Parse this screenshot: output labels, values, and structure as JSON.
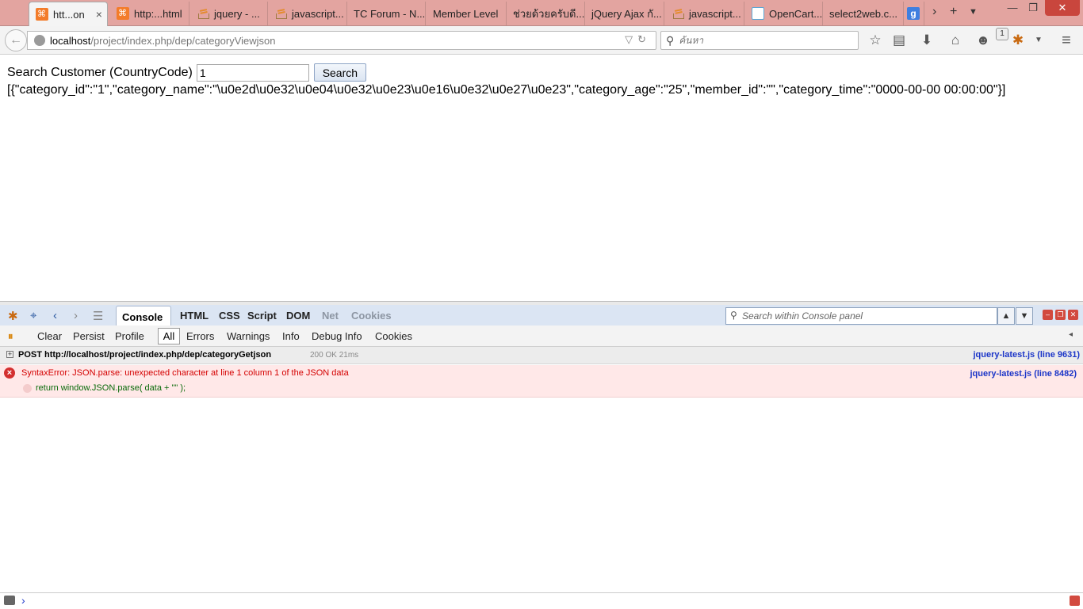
{
  "tabs": [
    {
      "label": "htt...on",
      "icon": "xampp-icon",
      "active": true
    },
    {
      "label": "http:...html",
      "icon": "xampp-icon"
    },
    {
      "label": "jquery - ...",
      "icon": "stackoverflow-icon"
    },
    {
      "label": "javascript...",
      "icon": "stackoverflow-icon"
    },
    {
      "label": "TC Forum - N...",
      "icon": ""
    },
    {
      "label": "Member Level",
      "icon": ""
    },
    {
      "label": "ช่วยด้วยครับดี...",
      "icon": ""
    },
    {
      "label": "jQuery Ajax กั...",
      "icon": ""
    },
    {
      "label": "javascript...",
      "icon": "stackoverflow-icon"
    },
    {
      "label": "OpenCart...",
      "icon": "opencart-icon"
    },
    {
      "label": "select2web.c...",
      "icon": ""
    }
  ],
  "tab_close": "×",
  "window": {
    "min": "—",
    "restore": "❐",
    "close": "✕"
  },
  "nav": {
    "url_host": "localhost",
    "url_path": "/project/index.php/dep/categoryViewjson",
    "search_placeholder": "ค้นหา",
    "notification_count": "1"
  },
  "page": {
    "search_label": "Search Customer (CountryCode)",
    "country_value": "1",
    "search_button": "Search",
    "json_output": "[{\"category_id\":\"1\",\"category_name\":\"\\u0e2d\\u0e32\\u0e04\\u0e32\\u0e23\\u0e16\\u0e32\\u0e27\\u0e23\",\"category_age\":\"25\",\"member_id\":\"\",\"category_time\":\"0000-00-00 00:00:00\"}]"
  },
  "firebug": {
    "panel_tabs": [
      "HTML",
      "CSS",
      "Script",
      "DOM",
      "Net",
      "Cookies"
    ],
    "active_tab": "Console",
    "search_placeholder": "Search within Console panel",
    "sub_toolbar": [
      "Clear",
      "Persist",
      "Profile"
    ],
    "filters": [
      "All",
      "Errors",
      "Warnings",
      "Info",
      "Debug Info",
      "Cookies"
    ],
    "log": {
      "request": "POST http://localhost/project/index.php/dep/categoryGetjson",
      "request_status": "200 OK",
      "request_time": "21ms",
      "request_source": "jquery-latest.js (line 9631)",
      "error_message": "SyntaxError: JSON.parse: unexpected character at line 1 column 1 of the JSON data",
      "error_code": "return window.JSON.parse( data + \"\" );",
      "error_source": "jquery-latest.js (line 8482)"
    },
    "prompt": "›"
  }
}
